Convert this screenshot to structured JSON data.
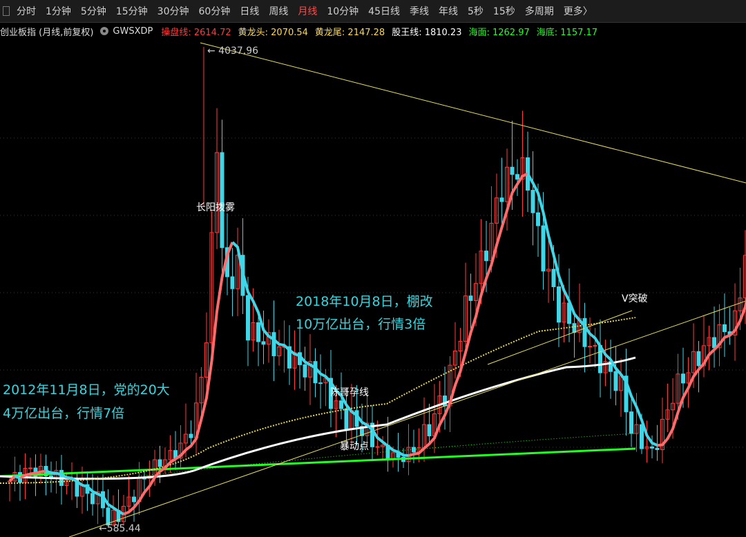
{
  "toolbar": {
    "tabs": [
      "分时",
      "1分钟",
      "5分钟",
      "15分钟",
      "30分钟",
      "60分钟",
      "日线",
      "周线",
      "月线",
      "10分钟",
      "45日线",
      "季线",
      "年线",
      "5秒",
      "15秒",
      "多周期",
      "更多〉"
    ],
    "active_tab": "月线"
  },
  "infobar": {
    "title": "创业板指 (月线,前复权)",
    "indicator": "GWSXDP",
    "items": [
      {
        "label": "操盘线:",
        "value": "2614.72",
        "color": "#ff3a3a"
      },
      {
        "label": "黄龙头:",
        "value": "2070.54",
        "color": "#ffd84a"
      },
      {
        "label": "黄龙尾:",
        "value": "2147.28",
        "color": "#ffd84a"
      },
      {
        "label": "股王线:",
        "value": "1810.23",
        "color": "#ffffff"
      },
      {
        "label": "海面:",
        "value": "1262.97",
        "color": "#22ff22"
      },
      {
        "label": "海底:",
        "value": "1157.17",
        "color": "#22ff22"
      }
    ]
  },
  "chart_data": {
    "type": "candlestick",
    "ylim": [
      500,
      4200
    ],
    "high_label": "4037.96",
    "low_label": "585.44",
    "annotations": [
      {
        "text": "长阳拨雾",
        "color": "#ffffff"
      },
      {
        "text": "2018年10月8日，棚改",
        "color": "#34d6e0"
      },
      {
        "text": "10万亿出台，行情3倍",
        "color": "#34d6e0"
      },
      {
        "text": "2012年11月8日，党的20大",
        "color": "#34d6e0"
      },
      {
        "text": "4万亿出台，行情7倍",
        "color": "#34d6e0"
      },
      {
        "text": "陈哥孕线",
        "color": "#ffffff"
      },
      {
        "text": "暴动点",
        "color": "#ffffff"
      },
      {
        "text": "V突破",
        "color": "#ffffff"
      }
    ]
  }
}
